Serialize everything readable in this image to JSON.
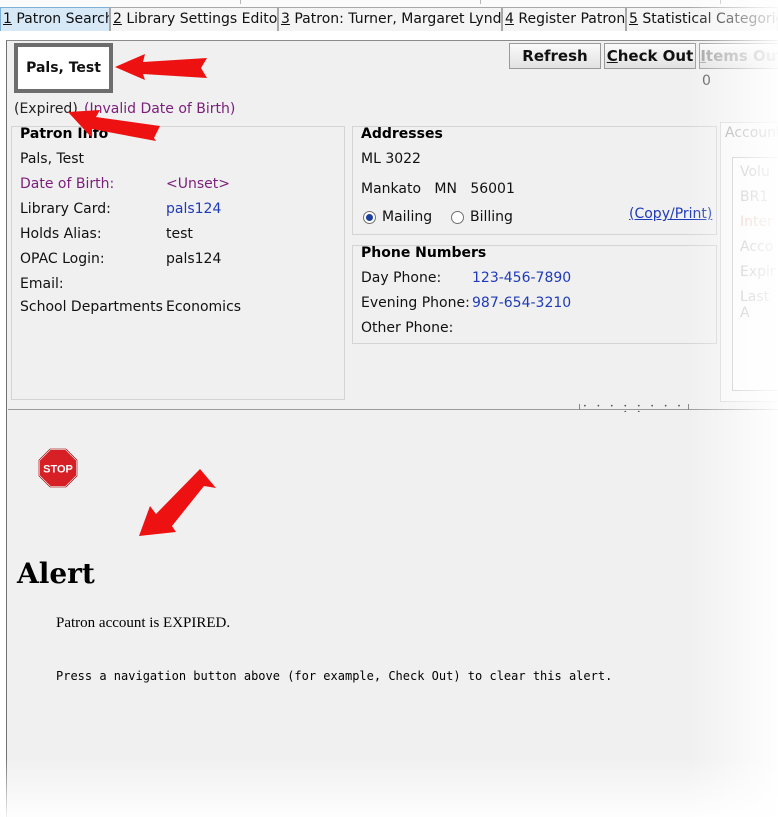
{
  "tabs": [
    {
      "num": "1",
      "label": " Patron Search"
    },
    {
      "num": "2",
      "label": " Library Settings Editor"
    },
    {
      "num": "3",
      "label": " Patron: Turner, Margaret Lynda"
    },
    {
      "num": "4",
      "label": " Register Patron"
    },
    {
      "num": "5",
      "label": " Statistical Categories"
    }
  ],
  "header": {
    "patron_name": "Pals, Test",
    "refresh": "Refresh",
    "check_out_accel": "C",
    "check_out_rest": "heck Out",
    "items_out_accel": "I",
    "items_out_rest": "tems Out",
    "items_out_count": "0"
  },
  "status": {
    "expired": "(Expired)",
    "dob_warning": "(Invalid Date of Birth)"
  },
  "patron_info": {
    "title": "Patron Info",
    "name": "Pals, Test",
    "dob_label": "Date of Birth:",
    "dob_value": "<Unset>",
    "card_label": "Library Card:",
    "card_value": "pals124",
    "alias_label": "Holds Alias:",
    "alias_value": "test",
    "opac_label": "OPAC Login:",
    "opac_value": "pals124",
    "email_label": "Email:",
    "dept_label": "School Departments",
    "dept_value": "Economics"
  },
  "addresses": {
    "title": "Addresses",
    "line1": "ML 3022",
    "city": "Mankato",
    "state": "MN",
    "zip": "56001",
    "mailing": "Mailing",
    "billing": "Billing",
    "copy_print": "(Copy/Print)"
  },
  "phones": {
    "title": "Phone Numbers",
    "day_label": "Day Phone:",
    "day_value": "123-456-7890",
    "evening_label": "Evening Phone:",
    "evening_value": "987-654-3210",
    "other_label": "Other Phone:"
  },
  "account": {
    "title": "Account",
    "rows": [
      "Volu",
      "BR1",
      "Inter",
      "Acco",
      "Expir",
      "Last A"
    ]
  },
  "alert": {
    "stop": "STOP",
    "title": "Alert",
    "message": "Patron account is EXPIRED.",
    "hint": "Press a navigation button above (for example, Check Out) to clear this alert."
  },
  "colors": {
    "link": "#1f3ab8",
    "warning": "#7a1e7a",
    "arrow": "#ee1111",
    "stop": "#d71f26"
  }
}
